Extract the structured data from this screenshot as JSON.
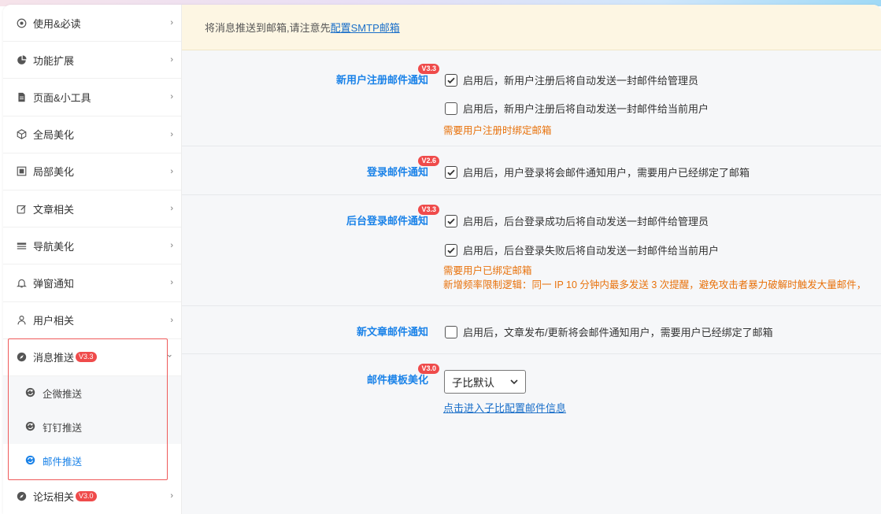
{
  "sidebar": {
    "items": [
      {
        "label": "使用&必读",
        "icon": "target-icon"
      },
      {
        "label": "功能扩展",
        "icon": "pie-icon"
      },
      {
        "label": "页面&小工具",
        "icon": "page-icon"
      },
      {
        "label": "全局美化",
        "icon": "cube-icon"
      },
      {
        "label": "局部美化",
        "icon": "frame-icon"
      },
      {
        "label": "文章相关",
        "icon": "edit-icon"
      },
      {
        "label": "导航美化",
        "icon": "nav-icon"
      },
      {
        "label": "弹窗通知",
        "icon": "bell-icon"
      },
      {
        "label": "用户相关",
        "icon": "user-icon"
      },
      {
        "label": "消息推送",
        "badge": "V3.3",
        "icon": "compass-icon",
        "expanded": true
      }
    ],
    "subitems": [
      {
        "label": "企微推送",
        "icon": "sync-icon"
      },
      {
        "label": "钉钉推送",
        "icon": "sync-icon"
      },
      {
        "label": "邮件推送",
        "icon": "sync-icon",
        "active": true
      }
    ],
    "last_item": {
      "label": "论坛相关",
      "badge": "V3.0",
      "icon": "compass-icon"
    },
    "chevron_right": "›",
    "chevron_down": "⌄"
  },
  "notice": {
    "text": "将消息推送到邮箱,请注意先",
    "link": "配置SMTP邮箱"
  },
  "sections": {
    "register": {
      "label": "新用户注册邮件通知",
      "badge": "V3.3",
      "opt1": "启用后，新用户注册后将自动发送一封邮件给管理员",
      "opt2": "启用后，新用户注册后将自动发送一封邮件给当前用户",
      "warn": "需要用户注册时绑定邮箱"
    },
    "login": {
      "label": "登录邮件通知",
      "badge": "V2.6",
      "opt1": "启用后，用户登录将会邮件通知用户，需要用户已经绑定了邮箱"
    },
    "admin_login": {
      "label": "后台登录邮件通知",
      "badge": "V3.3",
      "opt1": "启用后，后台登录成功后将自动发送一封邮件给管理员",
      "opt2": "启用后，后台登录失败后将自动发送一封邮件给当前用户",
      "warn1": "需要用户已绑定邮箱",
      "warn2": "新增频率限制逻辑：同一 IP 10 分钟内最多发送 3 次提醒，避免攻击者暴力破解时触发大量邮件，"
    },
    "new_post": {
      "label": "新文章邮件通知",
      "opt1": "启用后，文章发布/更新将会邮件通知用户，需要用户已经绑定了邮箱"
    },
    "template": {
      "label": "邮件模板美化",
      "badge": "V3.0",
      "select_value": "子比默认",
      "link": "点击进入子比配置邮件信息"
    }
  },
  "colors": {
    "accent": "#1a82e8",
    "badge": "#ef4b4b",
    "warn": "#e8720c",
    "highlight": "#ef5a5a"
  }
}
